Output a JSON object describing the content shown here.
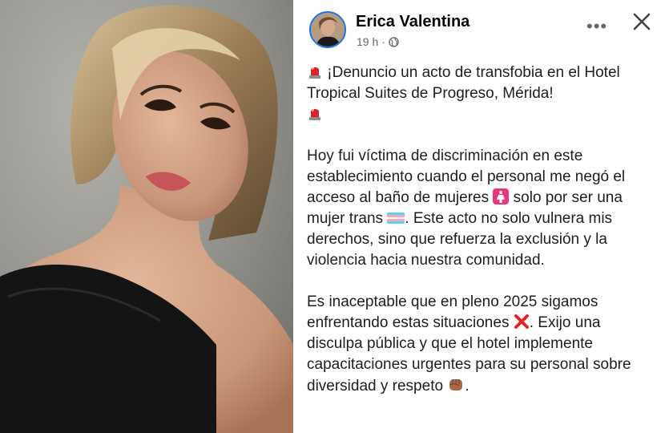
{
  "post": {
    "author": "Erica Valentina",
    "timestamp": "19 h",
    "separator": "·",
    "more_label": "•••",
    "paragraph1_a": "¡Denuncio un acto de transfobia en el Hotel Tropical Suites de Progreso, Mérida!",
    "paragraph2_a": "Hoy fui víctima de discriminación en este establecimiento cuando el personal me negó el acceso al baño de mujeres",
    "paragraph2_b": "solo por ser una mujer trans",
    "paragraph2_c": ". Este acto no solo vulnera mis derechos, sino que refuerza la exclusión y la violencia hacia nuestra comunidad.",
    "paragraph3_a": "Es inaceptable que en pleno 2025 sigamos enfrentando estas situaciones",
    "paragraph3_b": ". Exijo una disculpa pública y que el hotel implemente capacitaciones urgentes para su personal sobre diversidad y respeto",
    "paragraph3_c": "."
  },
  "icons": {
    "siren": "police-siren-icon",
    "womens_room": "womens-room-icon",
    "trans_flag": "transgender-flag-icon",
    "cross": "cross-mark-icon",
    "fist": "raised-fist-icon",
    "audience": "globe-icon",
    "close": "close-icon",
    "more": "more-options-icon"
  },
  "colors": {
    "author_text": "#050505",
    "meta_text": "#65676b",
    "body_text": "#1c1e21",
    "avatar_ring": "#1b74e4",
    "trans_blue": "#5bcefa",
    "trans_pink": "#f5a9b8",
    "cross_red": "#e0242b",
    "siren_red": "#d7252c",
    "womens_magenta": "#e8377d"
  }
}
